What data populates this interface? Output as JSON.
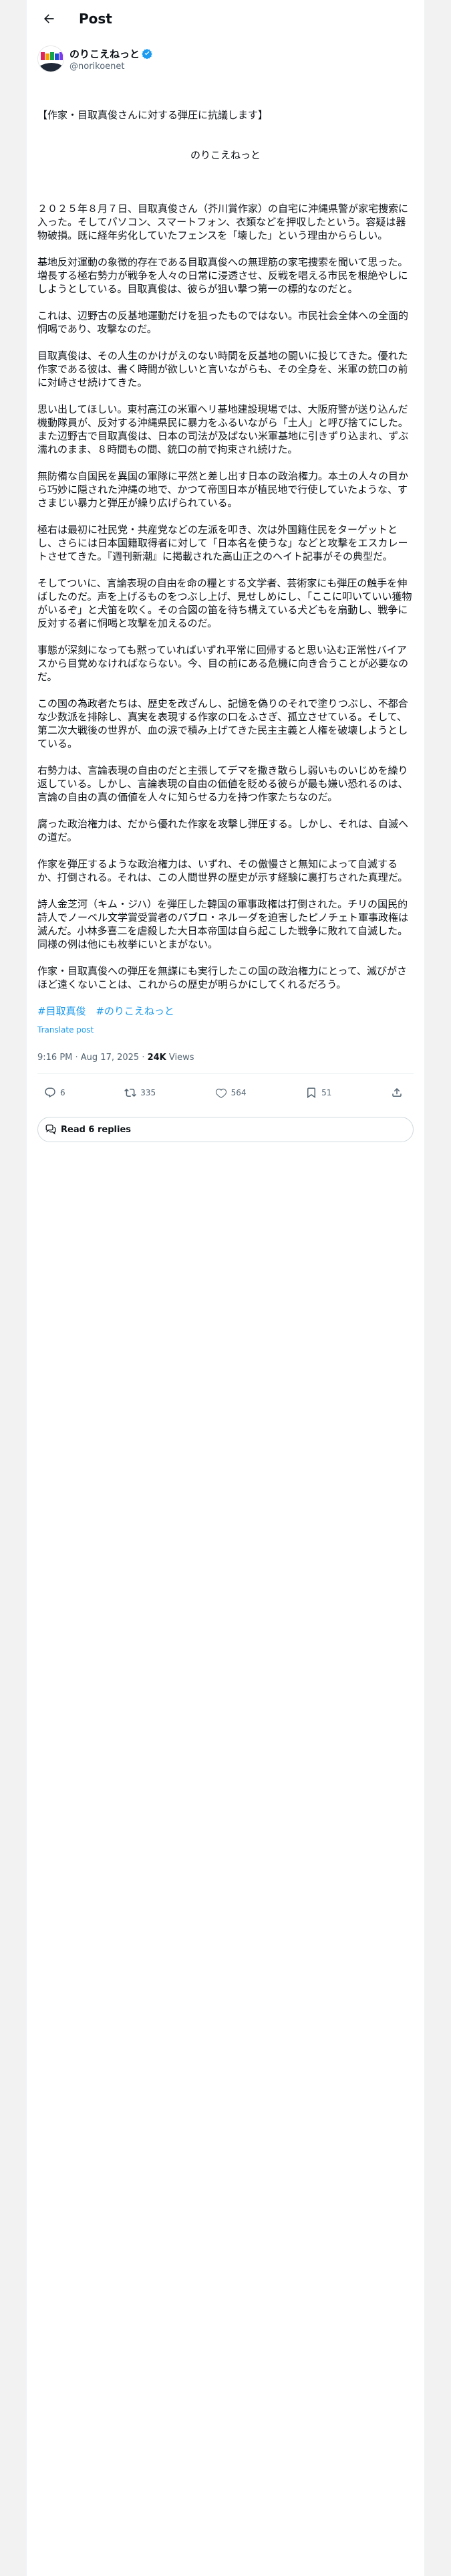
{
  "header": {
    "title": "Post"
  },
  "author": {
    "name": "のりこえねっと",
    "handle": "@norikoenet"
  },
  "post": {
    "heading": "【作家・目取真俊さんに対する弾圧に抗議します】",
    "heading_sub": "のりこえねっと",
    "paragraphs": [
      "２０２５年８月７日、目取真俊さん（芥川賞作家）の自宅に沖縄県警が家宅捜索に入った。そしてパソコン、スマートフォン、衣類などを押収したという。容疑は器物破損。既に経年劣化していたフェンスを「壊した」という理由かららしい。",
      "基地反対運動の象徴的存在である目取真俊への無理筋の家宅捜索を聞いて思った。増長する極右勢力が戦争を人々の日常に浸透させ、反戦を唱える市民を根絶やしにしようとしている。目取真俊は、彼らが狙い撃つ第一の標的なのだと。",
      "これは、辺野古の反基地運動だけを狙ったものではない。市民社会全体への全面的恫喝であり、攻撃なのだ。",
      "目取真俊は、その人生のかけがえのない時間を反基地の闘いに投じてきた。優れた作家である彼は、書く時間が欲しいと言いながらも、その全身を、米軍の銃口の前に対峙させ続けてきた。",
      "思い出してほしい。東村高江の米軍ヘリ基地建設現場では、大阪府警が送り込んだ機動隊員が、反対する沖縄県民に暴力をふるいながら「土人」と呼び捨てにした。また辺野古で目取真俊は、日本の司法が及ばない米軍基地に引きずり込まれ、ずぶ濡れのまま、８時間もの間、銃口の前で拘束され続けた。",
      "無防備な自国民を異国の軍隊に平然と差し出す日本の政治権力。本土の人々の目から巧妙に隠された沖縄の地で、かつて帝国日本が植民地で行使していたような、すさまじい暴力と弾圧が繰り広げられている。",
      "極右は最初に社民党・共産党などの左派を叩き、次は外国籍住民をターゲットとし、さらには日本国籍取得者に対して「日本名を使うな」などと攻撃をエスカレートさせてきた。『週刊新潮』に掲載された高山正之のヘイト記事がその典型だ。",
      "そしてついに、言論表現の自由を命の糧とする文学者、芸術家にも弾圧の触手を伸ばしたのだ。声を上げるものをつぶし上げ、見せしめにし、「ここに叩いていい獲物がいるぞ」と犬笛を吹く。その合図の笛を待ち構えている犬どもを扇動し、戦争に反対する者に恫喝と攻撃を加えるのだ。",
      "事態が深刻になっても黙っていればいずれ平常に回帰すると思い込む正常性バイアスから目覚めなければならない。今、目の前にある危機に向き合うことが必要なのだ。",
      "この国の為政者たちは、歴史を改ざんし、記憶を偽りのそれで塗りつぶし、不都合な少数派を排除し、真実を表現する作家の口をふさぎ、孤立させている。そして、第二次大戦後の世界が、血の涙で積み上げてきた民主主義と人権を破壊しようとしている。",
      "右勢力は、言論表現の自由のだと主張してデマを撒き散らし弱いものいじめを繰り返している。しかし、言論表現の自由の価値を貶める彼らが最も嫌い恐れるのは、言論の自由の真の価値を人々に知らせる力を持つ作家たちなのだ。",
      "腐った政治権力は、だから優れた作家を攻撃し弾圧する。しかし、それは、自滅への道だ。",
      "作家を弾圧するような政治権力は、いずれ、その傲慢さと無知によって自滅するか、打倒される。それは、この人間世界の歴史が示す経験に裏打ちされた真理だ。",
      "詩人金芝河（キム・ジハ）を弾圧した韓国の軍事政権は打倒された。チリの国民的詩人でノーベル文学賞受賞者のパブロ・ネルーダを迫害したピノチェト軍事政権は滅んだ。小林多喜二を虐殺した大日本帝国は自ら起こした戦争に敗れて自滅した。同様の例は他にも枚挙にいとまがない。",
      "作家・目取真俊への弾圧を無謀にも実行したこの国の政治権力にとって、滅びがさほど遠くないことは、これからの歴史が明らかにしてくれるだろう。"
    ],
    "hashtags": [
      "#目取真俊",
      "#のりこえねっと"
    ],
    "translate_label": "Translate post",
    "timestamp": "9:16 PM · Aug 17, 2025 · ",
    "views_count": "24K",
    "views_label": " Views"
  },
  "actions": {
    "replies": "6",
    "reposts": "335",
    "likes": "564",
    "bookmarks": "51"
  },
  "read_replies_label": "Read 6 replies",
  "colors": {
    "accent": "#1d9bf0",
    "muted": "#536471",
    "text": "#0f1419"
  }
}
